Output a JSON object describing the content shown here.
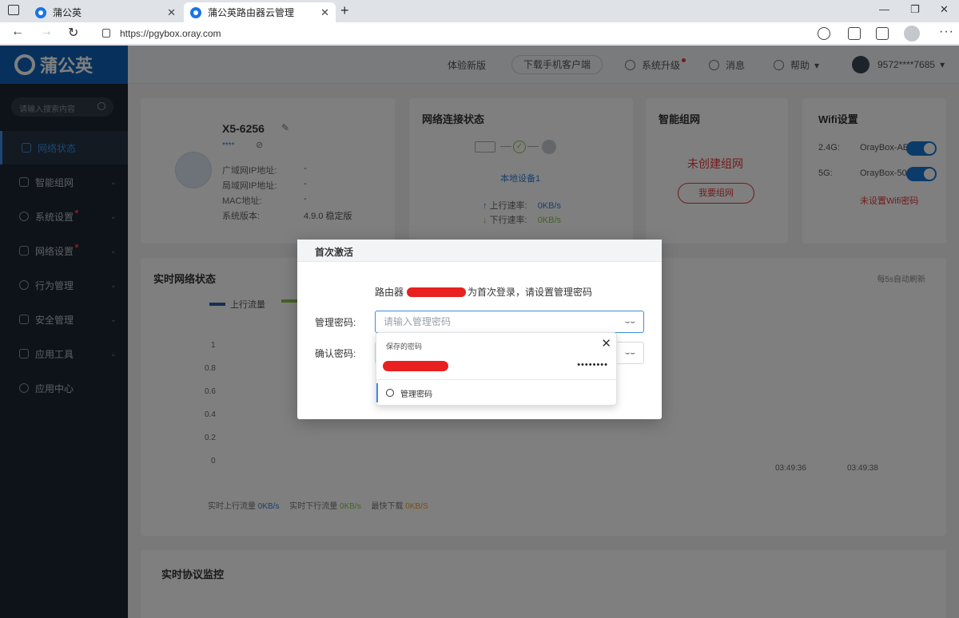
{
  "browser": {
    "tabs": [
      {
        "title": "蒲公英"
      },
      {
        "title": "蒲公英路由器云管理"
      }
    ],
    "url": "https://pgybox.oray.com"
  },
  "app": {
    "logo_text": "蒲公英",
    "search_placeholder": "请输入搜索内容",
    "menu": [
      {
        "label": "网络状态",
        "active": true
      },
      {
        "label": "智能组网"
      },
      {
        "label": "系统设置"
      },
      {
        "label": "网络设置"
      },
      {
        "label": "行为管理"
      },
      {
        "label": "安全管理"
      },
      {
        "label": "应用工具"
      },
      {
        "label": "应用中心"
      }
    ],
    "topbar": {
      "new_version": "体验新版",
      "download": "下载手机客户端",
      "upgrade": "系统升级",
      "messages": "消息",
      "help": "帮助",
      "account": "9572****7685"
    },
    "device": {
      "name": "X5-6256",
      "stars": "****",
      "wan_ip_label": "广域网IP地址:",
      "wan_ip": "-",
      "lan_ip_label": "局域网IP地址:",
      "lan_ip": "-",
      "mac_label": "MAC地址:",
      "mac": "-",
      "version_label": "系统版本:",
      "version": "4.9.0 稳定版"
    },
    "net_status": {
      "title": "网络连接状态",
      "local_device": "本地设备1",
      "up_label": "上行速率:",
      "up_value": "0KB/s",
      "down_label": "下行速率:",
      "down_value": "0KB/s"
    },
    "smart_net": {
      "title": "智能组网",
      "status": "未创建组网",
      "button": "我要组网"
    },
    "wifi": {
      "title": "Wifi设置",
      "band1": "2.4G:",
      "ssid1": "OrayBox-AE",
      "band2": "5G:",
      "ssid2": "OrayBox-50",
      "warning": "未设置Wifi密码"
    },
    "realtime": {
      "title": "实时网络状态",
      "refresh": "每5s自动刷新",
      "legend_up": "上行流量",
      "y_ticks": [
        "1",
        "0.8",
        "0.6",
        "0.4",
        "0.2",
        "0"
      ],
      "times": [
        "03:49:36",
        "03:49:38"
      ],
      "footer_up_label": "实时上行流量",
      "footer_up_value": "0KB/s",
      "footer_down_label": "实时下行流量",
      "footer_down_value": "0KB/s",
      "footer_max_label": "最快下载",
      "footer_max_value": "0KB/S"
    },
    "protocol": {
      "title": "实时协议监控"
    }
  },
  "modal": {
    "title": "首次激活",
    "desc_prefix": "路由器",
    "desc_suffix": "为首次登录，请设置管理密码",
    "pwd_label": "管理密码:",
    "pwd_placeholder": "请输入管理密码",
    "confirm_label": "确认密码:",
    "autofill": {
      "header": "保存的密码",
      "masked": "••••••••",
      "manage": "管理密码"
    }
  }
}
